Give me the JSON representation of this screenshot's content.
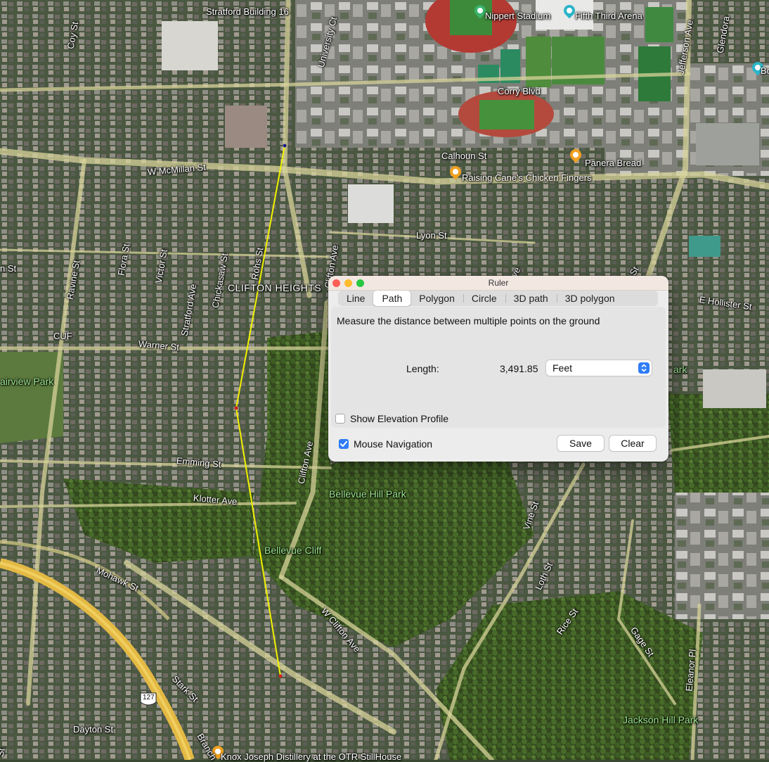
{
  "map": {
    "street_labels": [
      {
        "text": "Stratford Building 16",
        "cls": ""
      },
      {
        "text": "Coy St",
        "cls": ""
      },
      {
        "text": "University Ct",
        "cls": ""
      },
      {
        "text": "Nippert Stadium",
        "cls": ""
      },
      {
        "text": "Fifth Third Arena",
        "cls": ""
      },
      {
        "text": "Jefferson Ave",
        "cls": ""
      },
      {
        "text": "Glendora",
        "cls": ""
      },
      {
        "text": "Corry Blvd",
        "cls": ""
      },
      {
        "text": "Calhoun St",
        "cls": ""
      },
      {
        "text": "Panera Bread",
        "cls": ""
      },
      {
        "text": "Raising Cane's Chicken Fingers",
        "cls": ""
      },
      {
        "text": "W McMillan St",
        "cls": ""
      },
      {
        "text": "Lyon St",
        "cls": ""
      },
      {
        "text": "Clifton Ave",
        "cls": ""
      },
      {
        "text": "Rohs St",
        "cls": ""
      },
      {
        "text": "Chickasaw St",
        "cls": ""
      },
      {
        "text": "Stratford Ave",
        "cls": ""
      },
      {
        "text": "Victor St",
        "cls": ""
      },
      {
        "text": "Flora St",
        "cls": ""
      },
      {
        "text": "Ravine St",
        "cls": ""
      },
      {
        "text": "CLIFTON HEIGHTS",
        "cls": "big"
      },
      {
        "text": "CUF",
        "cls": ""
      },
      {
        "text": "Warner St",
        "cls": ""
      },
      {
        "text": "airview Park",
        "cls": "park"
      },
      {
        "text": "E Hollister St",
        "cls": ""
      },
      {
        "text": "ark",
        "cls": "park"
      },
      {
        "text": "Emming St",
        "cls": ""
      },
      {
        "text": "Clifton Ave",
        "cls": ""
      },
      {
        "text": "Klotter Ave",
        "cls": ""
      },
      {
        "text": "Bellevue Hill Park",
        "cls": "park"
      },
      {
        "text": "Bellevue Cliff",
        "cls": "park"
      },
      {
        "text": "Vine St",
        "cls": ""
      },
      {
        "text": "Mohawk St",
        "cls": ""
      },
      {
        "text": "W Clifton Ave",
        "cls": ""
      },
      {
        "text": "Loth St",
        "cls": ""
      },
      {
        "text": "Rice St",
        "cls": ""
      },
      {
        "text": "Gage St",
        "cls": ""
      },
      {
        "text": "Eleanor Pl",
        "cls": ""
      },
      {
        "text": "Stark St",
        "cls": ""
      },
      {
        "text": "127",
        "cls": ""
      },
      {
        "text": "Dayton St",
        "cls": ""
      },
      {
        "text": "Branch",
        "cls": ""
      },
      {
        "text": "Knox Joseph Distillery at the OTR StillHouse",
        "cls": ""
      },
      {
        "text": "Jackson Hill Park",
        "cls": "park"
      },
      {
        "text": "n St",
        "cls": ""
      },
      {
        "text": "St",
        "cls": ""
      },
      {
        "text": "St",
        "cls": ""
      },
      {
        "text": "ve",
        "cls": ""
      },
      {
        "text": "Bo",
        "cls": ""
      }
    ]
  },
  "ruler": {
    "title": "Ruler",
    "tabs": [
      "Line",
      "Path",
      "Polygon",
      "Circle",
      "3D path",
      "3D polygon"
    ],
    "selected_tab": "Path",
    "description": "Measure the distance between multiple points on the ground",
    "length_label": "Length:",
    "length_value": "3,491.85",
    "unit": "Feet",
    "show_elevation_label": "Show Elevation Profile",
    "show_elevation_checked": false,
    "mouse_nav_label": "Mouse Navigation",
    "mouse_nav_checked": true,
    "save_label": "Save",
    "clear_label": "Clear"
  },
  "colors": {
    "path_line": "#f2f200",
    "accent": "#2f7cf6",
    "close": "#fe5f57",
    "minimize": "#febc2e",
    "zoom": "#28c840"
  }
}
